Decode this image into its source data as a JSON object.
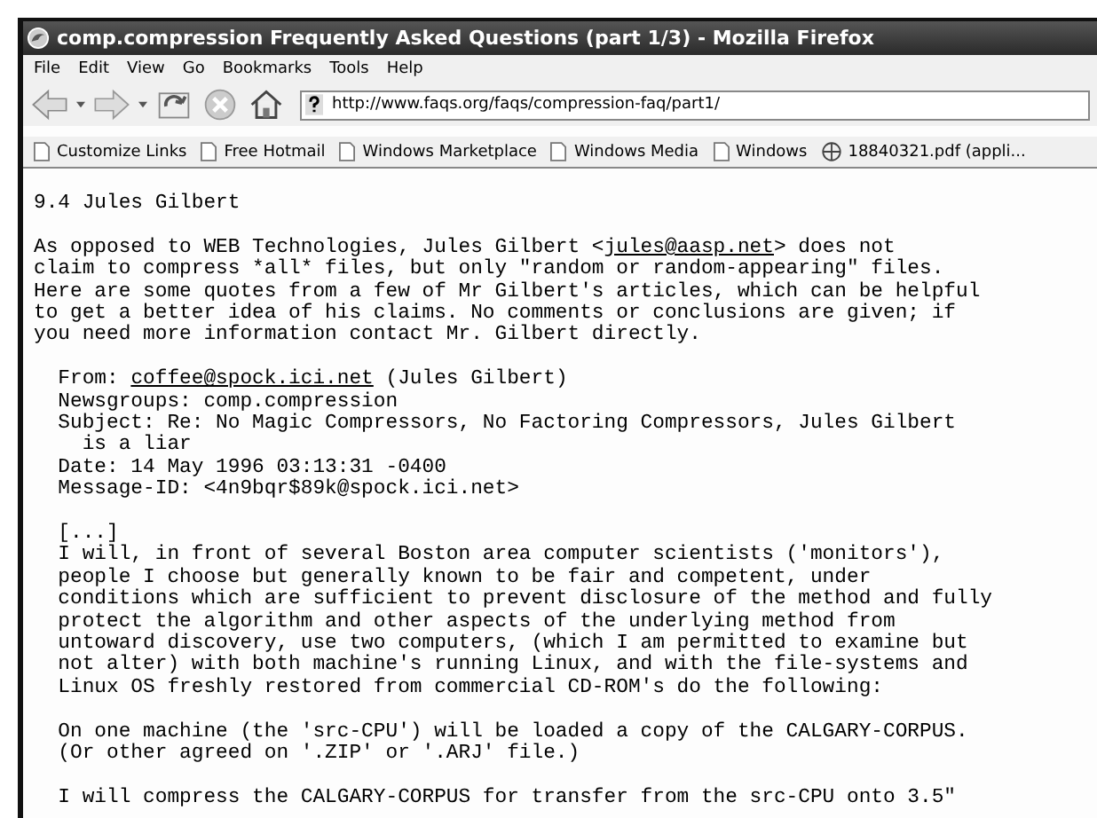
{
  "window": {
    "title": "comp.compression Frequently Asked Questions (part 1/3) - Mozilla Firefox"
  },
  "menu": [
    "File",
    "Edit",
    "View",
    "Go",
    "Bookmarks",
    "Tools",
    "Help"
  ],
  "address_bar": {
    "value": "http://www.faqs.org/faqs/compression-faq/part1/"
  },
  "bookmarks": [
    {
      "label": "Customize Links",
      "kind": "page"
    },
    {
      "label": "Free Hotmail",
      "kind": "page"
    },
    {
      "label": "Windows Marketplace",
      "kind": "page"
    },
    {
      "label": "Windows Media",
      "kind": "page"
    },
    {
      "label": "Windows",
      "kind": "page"
    },
    {
      "label": "18840321.pdf (appli...",
      "kind": "site"
    }
  ],
  "content": [
    {
      "parts": [
        {
          "kind": "text",
          "text": "9.4 Jules Gilbert"
        }
      ]
    },
    {
      "parts": [
        {
          "kind": "text",
          "text": "As opposed to WEB Technologies, Jules Gilbert <"
        },
        {
          "kind": "link",
          "text": "jules@aasp.net"
        },
        {
          "kind": "text",
          "text": "> does not\nclaim to compress *all* files, but only \"random or random-appearing\" files.\nHere are some quotes from a few of Mr Gilbert's articles, which can be helpful\nto get a better idea of his claims. No comments or conclusions are given; if\nyou need more information contact Mr. Gilbert directly."
        }
      ]
    },
    {
      "parts": [
        {
          "kind": "text",
          "text": "  From: "
        },
        {
          "kind": "link",
          "text": "coffee@spock.ici.net"
        },
        {
          "kind": "text",
          "text": " (Jules Gilbert)\n  Newsgroups: comp.compression\n  Subject: Re: No Magic Compressors, No Factoring Compressors, Jules Gilbert\n    is a liar\n  Date: 14 May 1996 03:13:31 -0400\n  Message-ID: <4n9bqr$89k@spock.ici.net>"
        }
      ]
    },
    {
      "parts": [
        {
          "kind": "text",
          "text": "  [...]\n  I will, in front of several Boston area computer scientists ('monitors'),\n  people I choose but generally known to be fair and competent, under\n  conditions which are sufficient to prevent disclosure of the method and fully\n  protect the algorithm and other aspects of the underlying method from\n  untoward discovery, use two computers, (which I am permitted to examine but\n  not alter) with both machine's running Linux, and with the file-systems and\n  Linux OS freshly restored from commercial CD-ROM's do the following:"
        }
      ]
    },
    {
      "parts": [
        {
          "kind": "text",
          "text": "  On one machine (the 'src-CPU') will be loaded a copy of the CALGARY-CORPUS.\n  (Or other agreed on '.ZIP' or '.ARJ' file.)"
        }
      ]
    },
    {
      "parts": [
        {
          "kind": "text",
          "text": "  I will compress the CALGARY-CORPUS for transfer from the src-CPU onto 3.5\""
        }
      ]
    }
  ]
}
